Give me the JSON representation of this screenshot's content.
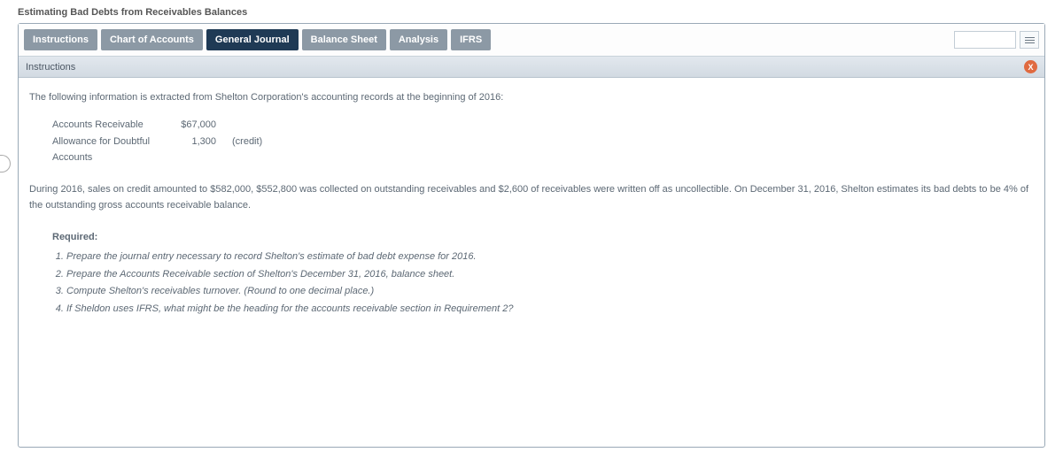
{
  "title": "Estimating Bad Debts from Receivables Balances",
  "tabs": {
    "t0": "Instructions",
    "t1": "Chart of Accounts",
    "t2": "General Journal",
    "t3": "Balance Sheet",
    "t4": "Analysis",
    "t5": "IFRS"
  },
  "panel": {
    "header": "Instructions",
    "close": "X"
  },
  "content": {
    "intro": "The following information is extracted from Shelton Corporation's accounting records at the beginning of 2016:",
    "accounts": {
      "r0": {
        "label": "Accounts Receivable",
        "value": "$67,000",
        "note": ""
      },
      "r1": {
        "label": "Allowance for Doubtful Accounts",
        "value": "1,300",
        "note": "(credit)"
      }
    },
    "body": "During 2016, sales on credit amounted to $582,000, $552,800 was collected on outstanding receivables and $2,600 of receivables were written off as uncollectible. On December 31, 2016, Shelton estimates its bad debts to be 4% of the outstanding gross accounts receivable balance.",
    "required_title": "Required:",
    "required": {
      "r1": "Prepare the journal entry necessary to record Shelton's estimate of bad debt expense for 2016.",
      "r2": "Prepare the Accounts Receivable section of Shelton's December 31, 2016, balance sheet.",
      "r3": "Compute Shelton's receivables turnover. (Round to one decimal place.)",
      "r4": "If Sheldon uses IFRS, what might be the heading for the accounts receivable section in Requirement 2?"
    }
  }
}
